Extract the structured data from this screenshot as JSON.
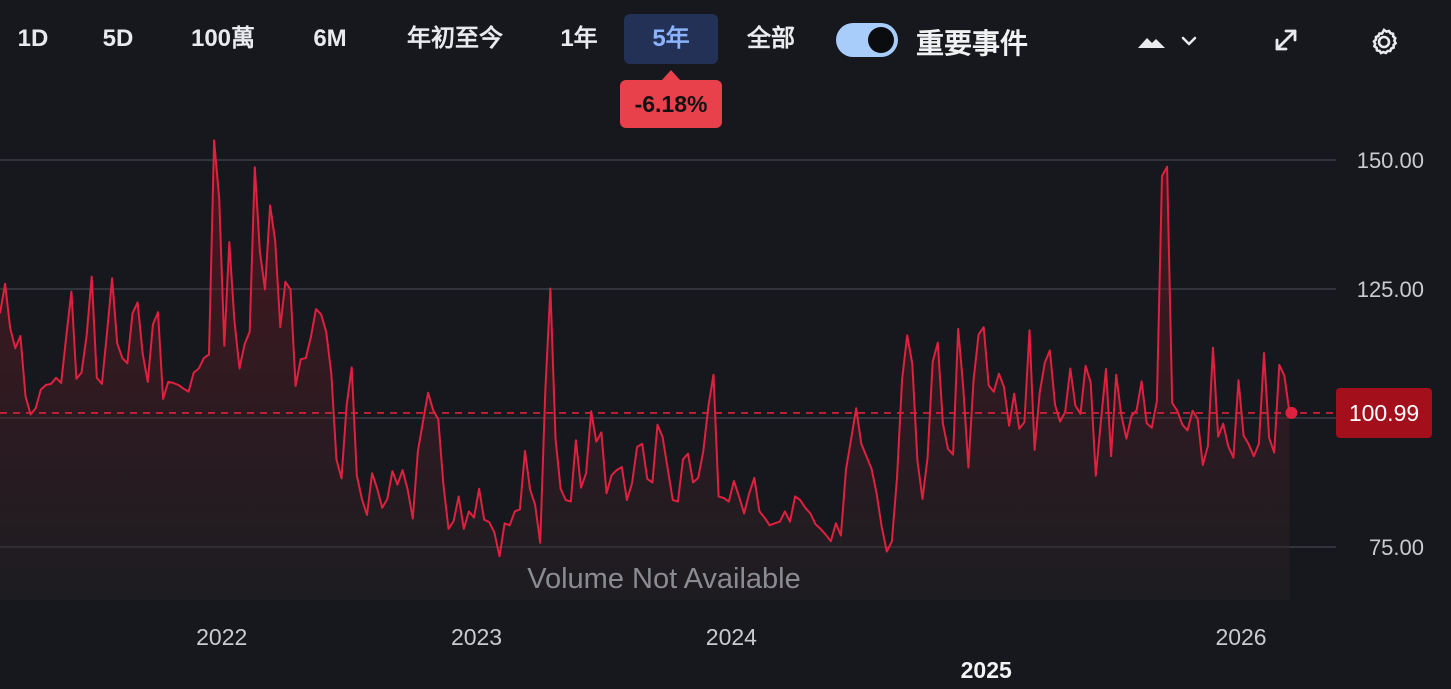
{
  "toolbar": {
    "ranges": [
      "1D",
      "5D",
      "100萬",
      "6M",
      "年初至今",
      "1年",
      "5年",
      "全部"
    ],
    "active_range": "5年",
    "events_toggle_label": "重要事件",
    "events_toggle_on": true,
    "chart_type_icon": "mountain-chart-icon",
    "dropdown_icon": "chevron-down-icon",
    "expand_icon": "expand-arrows-icon",
    "settings_icon": "gear-icon"
  },
  "change_badge": "-6.18%",
  "last_price": "100.99",
  "volume_note": "Volume Not Available",
  "colors": {
    "background": "#16181d",
    "line": "#e0203f",
    "badge": "#e8414c",
    "price_tag": "#a3101c",
    "active_tab": "#243157",
    "active_tab_text": "#8ab4ff",
    "toggle": "#a9cdfa"
  },
  "chart_data": {
    "type": "area",
    "title": "",
    "xlabel": "",
    "ylabel": "",
    "ylim": [
      65.5,
      167.7
    ],
    "xlim": [
      2021.13,
      2026.2
    ],
    "yticks": [
      75,
      100,
      125,
      150
    ],
    "ytick_labels": [
      "75.00",
      "",
      "125.00",
      "150.00"
    ],
    "xticks": [
      {
        "x": 2022,
        "label": "2022"
      },
      {
        "x": 2023,
        "label": "2023"
      },
      {
        "x": 2024,
        "label": "2024"
      },
      {
        "x": 2025,
        "label": "2025"
      },
      {
        "x": 2026,
        "label": "2026"
      }
    ],
    "reference_line": 100.99,
    "grid": true,
    "series": [
      {
        "values": [
          [
            2021.13,
            120.3
          ],
          [
            2021.15,
            126.0
          ],
          [
            2021.17,
            117.4
          ],
          [
            2021.19,
            113.5
          ],
          [
            2021.21,
            115.9
          ],
          [
            2021.23,
            104.2
          ],
          [
            2021.25,
            100.7
          ],
          [
            2021.27,
            101.9
          ],
          [
            2021.29,
            105.5
          ],
          [
            2021.31,
            106.4
          ],
          [
            2021.33,
            106.6
          ],
          [
            2021.35,
            107.8
          ],
          [
            2021.37,
            106.8
          ],
          [
            2021.39,
            115.9
          ],
          [
            2021.41,
            124.5
          ],
          [
            2021.43,
            107.6
          ],
          [
            2021.45,
            108.8
          ],
          [
            2021.47,
            115.9
          ],
          [
            2021.49,
            127.4
          ],
          [
            2021.51,
            107.8
          ],
          [
            2021.53,
            106.6
          ],
          [
            2021.55,
            116.5
          ],
          [
            2021.57,
            127.1
          ],
          [
            2021.59,
            114.5
          ],
          [
            2021.61,
            111.6
          ],
          [
            2021.63,
            110.6
          ],
          [
            2021.65,
            120.3
          ],
          [
            2021.67,
            122.4
          ],
          [
            2021.69,
            112.4
          ],
          [
            2021.71,
            107.0
          ],
          [
            2021.73,
            118.1
          ],
          [
            2021.75,
            120.5
          ],
          [
            2021.77,
            103.7
          ],
          [
            2021.79,
            107.0
          ],
          [
            2021.81,
            106.8
          ],
          [
            2021.83,
            106.4
          ],
          [
            2021.85,
            105.7
          ],
          [
            2021.87,
            105.1
          ],
          [
            2021.89,
            108.8
          ],
          [
            2021.91,
            109.6
          ],
          [
            2021.93,
            111.6
          ],
          [
            2021.95,
            112.3
          ],
          [
            2021.97,
            153.8
          ],
          [
            2021.99,
            142.6
          ],
          [
            2022.01,
            114.0
          ],
          [
            2022.03,
            134.1
          ],
          [
            2022.05,
            118.9
          ],
          [
            2022.07,
            109.6
          ],
          [
            2022.09,
            114.3
          ],
          [
            2022.11,
            116.7
          ],
          [
            2022.13,
            148.6
          ],
          [
            2022.15,
            132.2
          ],
          [
            2022.17,
            124.9
          ],
          [
            2022.19,
            141.2
          ],
          [
            2022.21,
            134.3
          ],
          [
            2022.23,
            117.6
          ],
          [
            2022.25,
            126.4
          ],
          [
            2022.27,
            124.9
          ],
          [
            2022.29,
            106.2
          ],
          [
            2022.31,
            111.4
          ],
          [
            2022.33,
            111.6
          ],
          [
            2022.35,
            115.7
          ],
          [
            2022.37,
            121.1
          ],
          [
            2022.39,
            120.1
          ],
          [
            2022.41,
            116.7
          ],
          [
            2022.43,
            108.6
          ],
          [
            2022.45,
            92.0
          ],
          [
            2022.47,
            88.3
          ],
          [
            2022.49,
            102.4
          ],
          [
            2022.51,
            109.8
          ],
          [
            2022.53,
            88.9
          ],
          [
            2022.55,
            84.3
          ],
          [
            2022.57,
            81.2
          ],
          [
            2022.59,
            89.3
          ],
          [
            2022.61,
            86.3
          ],
          [
            2022.63,
            82.6
          ],
          [
            2022.65,
            84.3
          ],
          [
            2022.67,
            89.7
          ],
          [
            2022.69,
            87.1
          ],
          [
            2022.71,
            89.9
          ],
          [
            2022.73,
            86.1
          ],
          [
            2022.75,
            80.5
          ],
          [
            2022.77,
            93.6
          ],
          [
            2022.79,
            99.3
          ],
          [
            2022.81,
            104.9
          ],
          [
            2022.83,
            101.5
          ],
          [
            2022.85,
            99.7
          ],
          [
            2022.87,
            87.1
          ],
          [
            2022.89,
            78.5
          ],
          [
            2022.91,
            80.0
          ],
          [
            2022.93,
            84.8
          ],
          [
            2022.95,
            78.5
          ],
          [
            2022.97,
            81.9
          ],
          [
            2022.99,
            80.7
          ],
          [
            2023.01,
            86.3
          ],
          [
            2023.03,
            80.3
          ],
          [
            2023.05,
            79.8
          ],
          [
            2023.07,
            77.8
          ],
          [
            2023.09,
            73.2
          ],
          [
            2023.11,
            79.6
          ],
          [
            2023.13,
            79.2
          ],
          [
            2023.15,
            81.9
          ],
          [
            2023.17,
            82.3
          ],
          [
            2023.19,
            93.6
          ],
          [
            2023.21,
            86.1
          ],
          [
            2023.23,
            83.2
          ],
          [
            2023.25,
            75.8
          ],
          [
            2023.27,
            105.3
          ],
          [
            2023.29,
            125.1
          ],
          [
            2023.31,
            96.1
          ],
          [
            2023.33,
            86.3
          ],
          [
            2023.35,
            84.1
          ],
          [
            2023.37,
            83.8
          ],
          [
            2023.39,
            95.7
          ],
          [
            2023.41,
            86.5
          ],
          [
            2023.43,
            89.3
          ],
          [
            2023.45,
            101.3
          ],
          [
            2023.47,
            95.4
          ],
          [
            2023.49,
            97.2
          ],
          [
            2023.51,
            85.4
          ],
          [
            2023.53,
            88.9
          ],
          [
            2023.55,
            89.9
          ],
          [
            2023.57,
            90.5
          ],
          [
            2023.59,
            84.1
          ],
          [
            2023.61,
            87.3
          ],
          [
            2023.63,
            94.4
          ],
          [
            2023.65,
            95.0
          ],
          [
            2023.67,
            88.2
          ],
          [
            2023.69,
            87.5
          ],
          [
            2023.71,
            98.7
          ],
          [
            2023.73,
            96.3
          ],
          [
            2023.75,
            90.2
          ],
          [
            2023.77,
            84.1
          ],
          [
            2023.79,
            83.8
          ],
          [
            2023.81,
            92.0
          ],
          [
            2023.83,
            93.1
          ],
          [
            2023.85,
            87.5
          ],
          [
            2023.87,
            88.4
          ],
          [
            2023.89,
            93.6
          ],
          [
            2023.91,
            102.3
          ],
          [
            2023.93,
            108.4
          ],
          [
            2023.95,
            84.8
          ],
          [
            2023.97,
            84.5
          ],
          [
            2023.99,
            83.8
          ],
          [
            2024.01,
            87.8
          ],
          [
            2024.03,
            84.8
          ],
          [
            2024.05,
            81.5
          ],
          [
            2024.07,
            85.4
          ],
          [
            2024.09,
            88.4
          ],
          [
            2024.11,
            81.9
          ],
          [
            2024.13,
            80.7
          ],
          [
            2024.15,
            79.2
          ],
          [
            2024.17,
            79.6
          ],
          [
            2024.19,
            79.9
          ],
          [
            2024.21,
            81.9
          ],
          [
            2024.23,
            79.9
          ],
          [
            2024.25,
            84.8
          ],
          [
            2024.27,
            84.1
          ],
          [
            2024.29,
            82.6
          ],
          [
            2024.31,
            81.5
          ],
          [
            2024.33,
            79.4
          ],
          [
            2024.35,
            78.5
          ],
          [
            2024.37,
            77.4
          ],
          [
            2024.39,
            76.1
          ],
          [
            2024.41,
            79.6
          ],
          [
            2024.43,
            77.2
          ],
          [
            2024.45,
            90.0
          ],
          [
            2024.47,
            95.9
          ],
          [
            2024.49,
            101.9
          ],
          [
            2024.51,
            95.0
          ],
          [
            2024.53,
            92.6
          ],
          [
            2024.55,
            90.2
          ],
          [
            2024.57,
            85.4
          ],
          [
            2024.59,
            78.9
          ],
          [
            2024.61,
            74.1
          ],
          [
            2024.63,
            76.1
          ],
          [
            2024.65,
            88.4
          ],
          [
            2024.67,
            107.5
          ],
          [
            2024.69,
            116.0
          ],
          [
            2024.71,
            110.5
          ],
          [
            2024.73,
            91.8
          ],
          [
            2024.75,
            84.3
          ],
          [
            2024.77,
            92.4
          ],
          [
            2024.79,
            110.9
          ],
          [
            2024.81,
            114.6
          ],
          [
            2024.83,
            98.9
          ],
          [
            2024.85,
            94.0
          ],
          [
            2024.87,
            92.9
          ],
          [
            2024.89,
            117.3
          ],
          [
            2024.91,
            105.8
          ],
          [
            2024.93,
            90.4
          ],
          [
            2024.95,
            107.2
          ],
          [
            2024.97,
            116.2
          ],
          [
            2024.99,
            117.6
          ],
          [
            2025.01,
            106.3
          ],
          [
            2025.03,
            105.1
          ],
          [
            2025.05,
            108.6
          ],
          [
            2025.07,
            106.0
          ],
          [
            2025.09,
            98.5
          ],
          [
            2025.11,
            104.7
          ],
          [
            2025.13,
            97.9
          ],
          [
            2025.15,
            99.2
          ],
          [
            2025.17,
            117.0
          ],
          [
            2025.19,
            93.8
          ],
          [
            2025.21,
            104.9
          ],
          [
            2025.23,
            110.7
          ],
          [
            2025.25,
            113.1
          ],
          [
            2025.27,
            102.6
          ],
          [
            2025.29,
            99.3
          ],
          [
            2025.31,
            101.2
          ],
          [
            2025.33,
            109.6
          ],
          [
            2025.35,
            102.4
          ],
          [
            2025.37,
            100.8
          ],
          [
            2025.39,
            110.1
          ],
          [
            2025.41,
            106.9
          ],
          [
            2025.43,
            88.8
          ],
          [
            2025.45,
            99.4
          ],
          [
            2025.47,
            109.5
          ],
          [
            2025.49,
            92.6
          ],
          [
            2025.51,
            108.4
          ],
          [
            2025.53,
            100.6
          ],
          [
            2025.55,
            96.0
          ],
          [
            2025.57,
            100.4
          ],
          [
            2025.59,
            101.5
          ],
          [
            2025.61,
            107.1
          ],
          [
            2025.63,
            99.0
          ],
          [
            2025.65,
            98.1
          ],
          [
            2025.67,
            103.3
          ],
          [
            2025.69,
            146.9
          ],
          [
            2025.71,
            148.7
          ],
          [
            2025.73,
            102.9
          ],
          [
            2025.75,
            101.4
          ],
          [
            2025.77,
            98.7
          ],
          [
            2025.79,
            97.6
          ],
          [
            2025.81,
            101.4
          ],
          [
            2025.83,
            99.8
          ],
          [
            2025.85,
            90.9
          ],
          [
            2025.87,
            94.6
          ],
          [
            2025.89,
            113.6
          ],
          [
            2025.91,
            96.4
          ],
          [
            2025.93,
            98.9
          ],
          [
            2025.95,
            94.5
          ],
          [
            2025.97,
            92.3
          ],
          [
            2025.99,
            107.3
          ],
          [
            2026.01,
            96.6
          ],
          [
            2026.03,
            94.9
          ],
          [
            2026.05,
            92.6
          ],
          [
            2026.07,
            95.0
          ],
          [
            2026.09,
            112.6
          ],
          [
            2026.11,
            96.2
          ],
          [
            2026.13,
            93.3
          ],
          [
            2026.15,
            110.3
          ],
          [
            2026.17,
            108.2
          ],
          [
            2026.19,
            100.99
          ]
        ]
      }
    ]
  }
}
